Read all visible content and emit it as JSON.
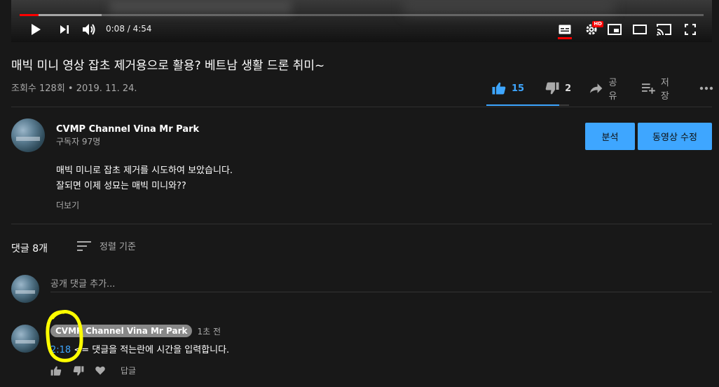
{
  "player": {
    "time_display": "0:08 / 4:54",
    "progress_played": 0.028,
    "progress_buffered": 0.12,
    "accent": "#ff0000",
    "icons": [
      "play-icon",
      "next-icon",
      "volume-icon",
      "subtitles-icon",
      "settings-icon",
      "miniplayer-icon",
      "theater-mode-icon",
      "cast-icon",
      "fullscreen-icon"
    ],
    "settings_badge": "HD"
  },
  "video": {
    "title": "매빅 미니 영상 잡초 제거용으로 활용? 베트남 생활 드론 취미~",
    "meta": "조회수 128회 • 2019. 11. 24.",
    "like_count": "15",
    "dislike_count": "2",
    "share_label": "공유",
    "save_label": "저장",
    "like_ratio": 0.882
  },
  "channel": {
    "name": "CVMP Channel Vina Mr Park",
    "subscribers": "구독자 97명",
    "analytics_label": "분석",
    "edit_label": "동영상 수정"
  },
  "description": {
    "line1": "매빅 미니로 잡초 제거를 시도하여 보았습니다.",
    "line2": "잘되면 이제 성묘는 매빅 미니와??",
    "more_label": "더보기"
  },
  "comments": {
    "count_label": "댓글 8개",
    "sort_label": "정렬 기준",
    "add_placeholder": "공개 댓글 추가...",
    "items": [
      {
        "author": "CVMP Channel Vina Mr Park",
        "time": "1초 전",
        "timestamp": "2:18",
        "text": " <= 댓글을 적는란에 시간을 입력합니다.",
        "reply_label": "답글"
      }
    ]
  },
  "colors": {
    "background": "#181818",
    "link_blue": "#3ea6ff",
    "highlight": "#ffff00"
  }
}
